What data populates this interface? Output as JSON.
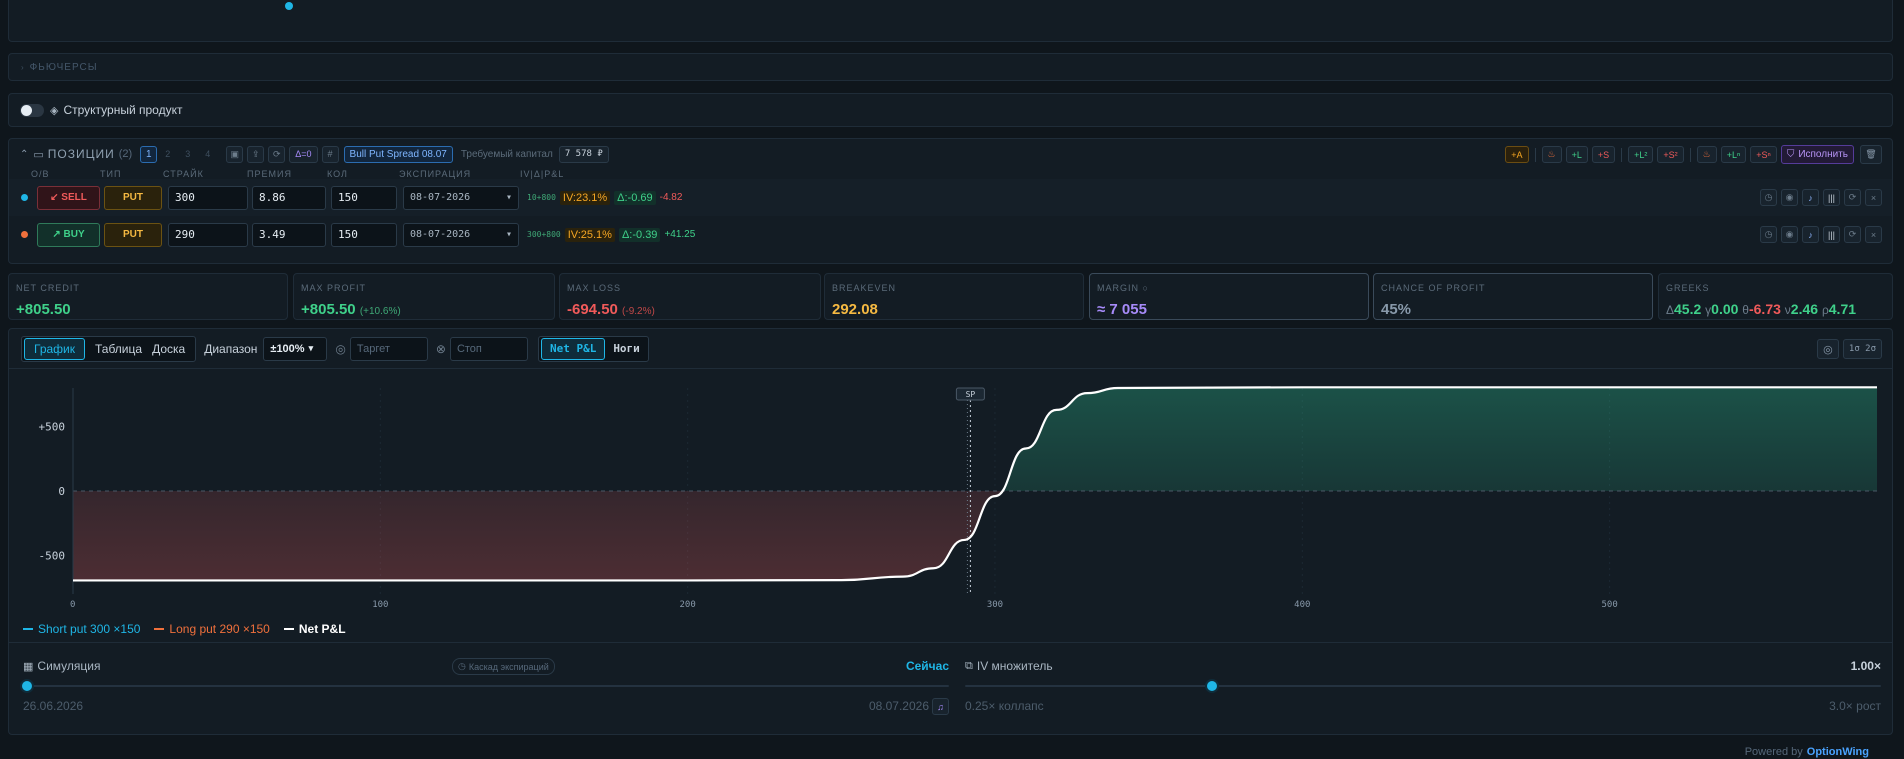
{
  "futures": {
    "label": "ФЬЮЧЕРСЫ"
  },
  "structured": {
    "label": "Структурный продукт"
  },
  "positions": {
    "title": "ПОЗИЦИИ",
    "count": "(2)",
    "pages": [
      "1",
      "2",
      "3",
      "4"
    ],
    "delta_badge": "Δ=0",
    "strategy": "Bull Put Spread 08.07",
    "capital_label": "Требуемый капитал",
    "capital_value": "7 578 ₽",
    "toolbar": {
      "a": "+A",
      "l": "+L",
      "s": "+S",
      "l2": "+L²",
      "s2": "+S²",
      "ln": "+Lⁿ",
      "sn": "+Sⁿ",
      "execute": "Исполнить"
    },
    "columns": [
      "O/B",
      "ТИП",
      "СТРАЙК",
      "ПРЕМИЯ",
      "КОЛ",
      "ЭКСПИРАЦИЯ",
      "IV|Δ|P&L"
    ],
    "rows": [
      {
        "side": "↙ SELL",
        "type": "PUT",
        "strike": "300",
        "premium": "8.86",
        "qty": "150",
        "expiry": "08-07-2026",
        "ref": "10+800",
        "iv": "IV:23.1%",
        "delta": "Δ:-0.69",
        "pnl": "-4.82",
        "dot": "#1fb6e6"
      },
      {
        "side": "↗ BUY",
        "type": "PUT",
        "strike": "290",
        "premium": "3.49",
        "qty": "150",
        "expiry": "08-07-2026",
        "ref": "300+800",
        "iv": "IV:25.1%",
        "delta": "Δ:-0.39",
        "pnl": "+41.25",
        "dot": "#f0703c"
      }
    ]
  },
  "stats": {
    "net_credit": {
      "label": "NET CREDIT",
      "value": "+805.50"
    },
    "max_profit": {
      "label": "MAX PROFIT",
      "value": "+805.50",
      "sub": "(+10.6%)"
    },
    "max_loss": {
      "label": "MAX LOSS",
      "value": "-694.50",
      "sub": "(-9.2%)"
    },
    "breakeven": {
      "label": "BREAKEVEN",
      "value": "292.08"
    },
    "margin": {
      "label": "MARGIN ○",
      "value": "≈ 7 055"
    },
    "chance": {
      "label": "CHANCE OF PROFIT",
      "value": "45%"
    },
    "greeks": {
      "label": "GREEKS",
      "d_sym": "Δ",
      "d": "45.2",
      "g_sym": "γ",
      "g": "0.00",
      "t_sym": "θ",
      "t": "-6.73",
      "v_sym": "ν",
      "v": "2.46",
      "r_sym": "ρ",
      "r": "4.71"
    }
  },
  "chart_toolbar": {
    "tabs": [
      "График",
      "Таблица",
      "Доска"
    ],
    "range_label": "Диапазон",
    "range_value": "±100%",
    "target_placeholder": "Таргет",
    "stop_placeholder": "Стоп",
    "mode_tabs": [
      "Net P&L",
      "Ноги"
    ],
    "right_label": "1σ 2σ"
  },
  "chart_data": {
    "type": "line",
    "x_ticks": [
      "0",
      "100",
      "200",
      "300",
      "400",
      "500"
    ],
    "y_ticks": [
      "+500",
      "0",
      "-500"
    ],
    "xlim": [
      0,
      587
    ],
    "ylim": [
      -800,
      800
    ],
    "spot_label": "SP",
    "spot": 292,
    "series": [
      {
        "name": "Net P&L",
        "x": [
          0,
          100,
          200,
          250,
          270,
          280,
          290,
          300,
          310,
          320,
          330,
          340,
          400,
          500,
          587
        ],
        "y": [
          -694.5,
          -694.5,
          -694.5,
          -692,
          -665,
          -600,
          -380,
          -40,
          330,
          630,
          760,
          800,
          805.5,
          805.5,
          805.5
        ]
      }
    ],
    "legend": [
      "Short put 300 ×150",
      "Long put 290 ×150",
      "Net P&L"
    ],
    "legend_colors": [
      "#1fb6e6",
      "#f0703c",
      "#ffffff"
    ]
  },
  "simulation": {
    "label": "Симуляция",
    "cascade": "Каскад экспираций",
    "now": "Сейчас",
    "start_date": "26.06.2026",
    "end_date": "08.07.2026",
    "slider_value": 0
  },
  "iv_mult": {
    "label": "IV множитель",
    "value": "1.00×",
    "min_label": "0.25× коллапс",
    "max_label": "3.0× рост",
    "level": 0.27
  },
  "footer": {
    "powered": "Powered by",
    "brand": "OptionWing"
  }
}
